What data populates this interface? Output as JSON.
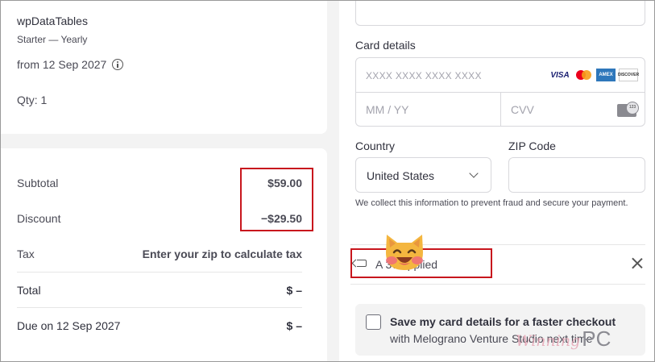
{
  "product": {
    "name": "wpDataTables",
    "plan": "Starter — Yearly",
    "from": "from 12 Sep 2027",
    "qty": "Qty: 1"
  },
  "summary": {
    "subtotal_label": "Subtotal",
    "subtotal_value": "$59.00",
    "discount_label": "Discount",
    "discount_value": "−$29.50",
    "tax_label": "Tax",
    "tax_value": "Enter your zip to calculate tax",
    "total_label": "Total",
    "total_value": "$ –",
    "due_label": "Due on 12 Sep 2027",
    "due_value": "$ –"
  },
  "payment": {
    "card_details_label": "Card details",
    "card_number_placeholder": "XXXX XXXX XXXX XXXX",
    "expiry_placeholder": "MM / YY",
    "cvv_placeholder": "CVV",
    "card_brands": [
      "VISA",
      "mastercard",
      "AMEX",
      "DISCOVER"
    ],
    "country_label": "Country",
    "country_value": "United States",
    "zip_label": "ZIP Code",
    "fraud_note": "We collect this information to prevent fraud and secure your payment."
  },
  "coupon": {
    "text": "A          37 applied",
    "icon": "tag-icon",
    "remove_icon": "close-icon"
  },
  "save_card": {
    "title": "Save my card details for a faster checkout",
    "subtitle": "with Melograno Venture Studio next time"
  },
  "watermark": {
    "script": "Winning",
    "pc": "PC"
  },
  "colors": {
    "highlight_box": "#c8161d",
    "text_primary": "#30313d",
    "border": "#d8d8dc"
  }
}
